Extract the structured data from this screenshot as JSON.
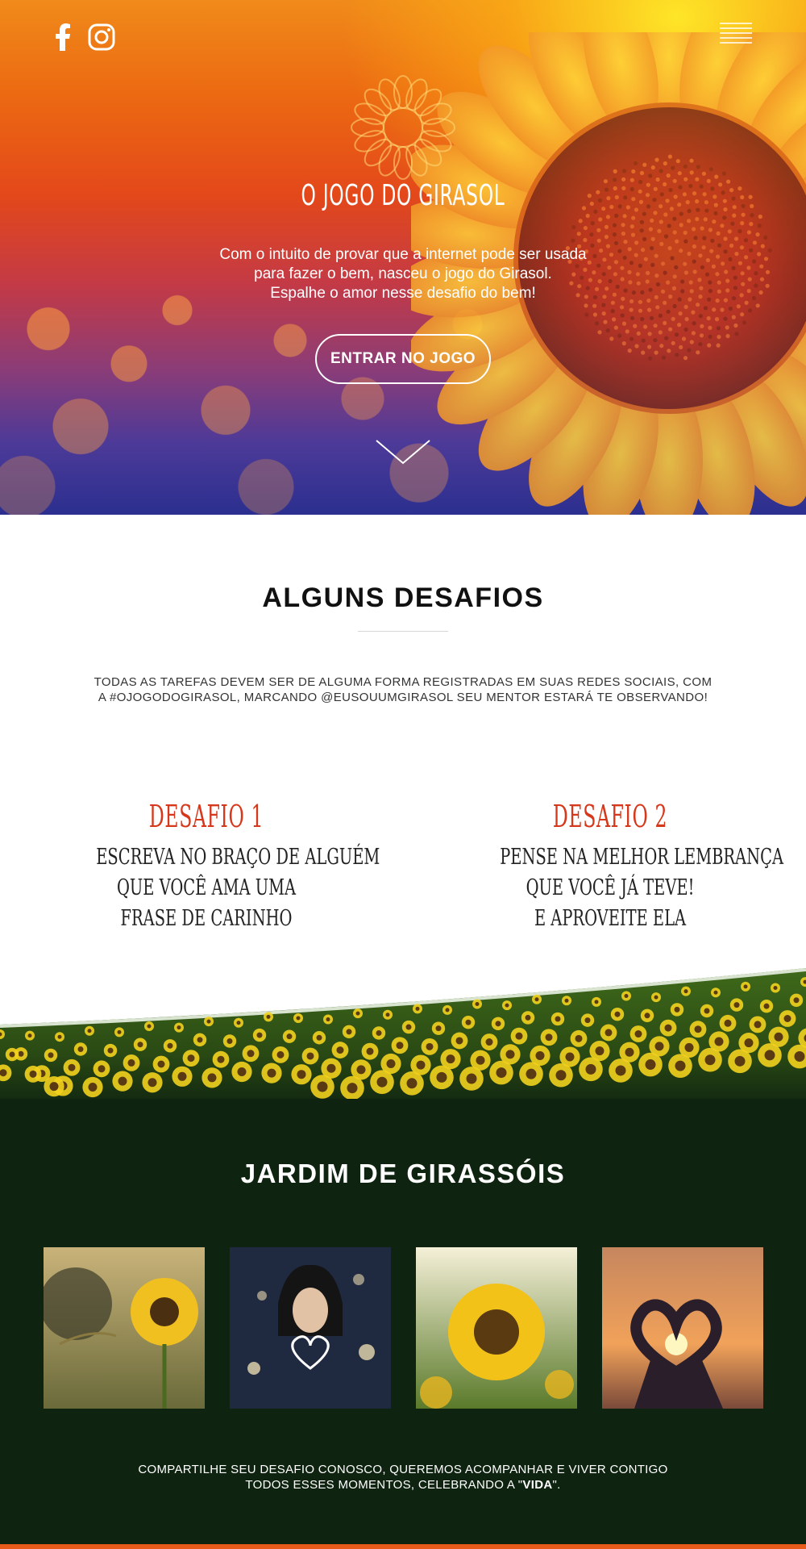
{
  "colors": {
    "accent_red": "#d6381c",
    "dark_green": "#0f2410",
    "white": "#ffffff"
  },
  "header": {
    "social": [
      "facebook-icon",
      "instagram-icon"
    ],
    "menu_icon": "hamburger-menu-icon"
  },
  "hero": {
    "logo_icon": "sunflower-outline-icon",
    "title": "O JOGO DO GIRASOL",
    "subtitle_lines": [
      "Com o intuito de provar que a internet pode ser usada",
      "para fazer o bem, nasceu o jogo do Girasol.",
      "Espalhe o amor nesse desafio do bem!"
    ],
    "cta_label": "ENTRAR NO JOGO",
    "scroll_icon": "chevron-down-icon"
  },
  "desafios": {
    "title": "ALGUNS DESAFIOS",
    "intro_lines": [
      "TODAS AS TAREFAS DEVEM SER DE ALGUMA FORMA REGISTRADAS EM SUAS REDES SOCIAIS, COM",
      "A #OJOGODOGIRASOL, MARCANDO @EUSOUUMGIRASOL SEU MENTOR ESTARÁ TE OBSERVANDO!"
    ],
    "items": [
      {
        "title": "DESAFIO 1",
        "lines": [
          "ESCREVA NO BRAÇO DE ALGUÉM",
          "QUE VOCÊ AMA UMA",
          "FRASE DE CARINHO"
        ]
      },
      {
        "title": "DESAFIO 2",
        "lines": [
          "PENSE NA MELHOR LEMBRANÇA",
          "QUE VOCÊ JÁ TEVE!",
          "E APROVEITE ELA"
        ]
      }
    ]
  },
  "jardim": {
    "title": "JARDIM DE GIRASSÓIS",
    "photos": [
      "sunflower-sunset-photo",
      "girl-light-heart-photo",
      "sunflower-field-photo",
      "heart-hands-sunset-photo"
    ],
    "footer_line1": "COMPARTILHE SEU DESAFIO CONOSCO, QUEREMOS ACOMPANHAR E VIVER CONTIGO",
    "footer_line2_prefix": "TODOS ESSES MOMENTOS, CELEBRANDO A \"",
    "footer_line2_bold": "VIDA",
    "footer_line2_suffix": "\"."
  }
}
